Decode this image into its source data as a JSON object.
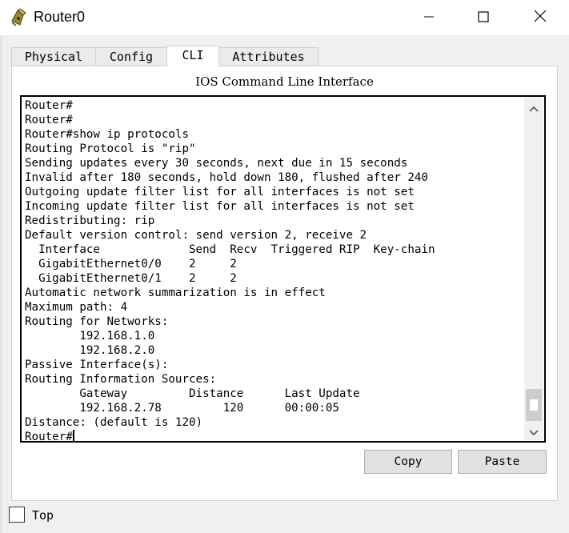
{
  "window": {
    "title": "Router0",
    "icon": "router-app-icon",
    "controls": [
      "minimize-icon",
      "maximize-icon",
      "close-icon"
    ]
  },
  "tabs": [
    {
      "label": "Physical",
      "active": false
    },
    {
      "label": "Config",
      "active": false
    },
    {
      "label": "CLI",
      "active": true
    },
    {
      "label": "Attributes",
      "active": false
    }
  ],
  "cli": {
    "heading": "IOS Command Line Interface",
    "lines": [
      "Router#",
      "Router#",
      "Router#show ip protocols",
      "Routing Protocol is \"rip\"",
      "Sending updates every 30 seconds, next due in 15 seconds",
      "Invalid after 180 seconds, hold down 180, flushed after 240",
      "Outgoing update filter list for all interfaces is not set",
      "Incoming update filter list for all interfaces is not set",
      "Redistributing: rip",
      "Default version control: send version 2, receive 2",
      "  Interface             Send  Recv  Triggered RIP  Key-chain",
      "  GigabitEthernet0/0    2     2",
      "  GigabitEthernet0/1    2     2",
      "Automatic network summarization is in effect",
      "Maximum path: 4",
      "Routing for Networks:",
      "        192.168.1.0",
      "        192.168.2.0",
      "Passive Interface(s):",
      "Routing Information Sources:",
      "        Gateway         Distance      Last Update",
      "        192.168.2.78         120      00:00:05",
      "Distance: (default is 120)"
    ],
    "prompt": "Router#"
  },
  "buttons": {
    "copy": "Copy",
    "paste": "Paste"
  },
  "footer": {
    "top_label": "Top",
    "top_checked": false
  }
}
